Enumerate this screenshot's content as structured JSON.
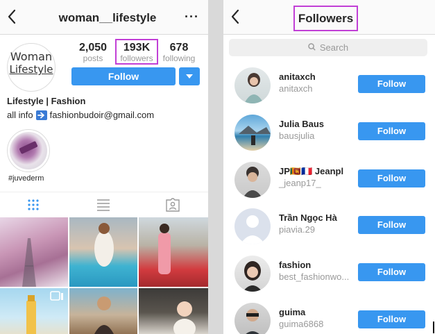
{
  "left_panel": {
    "username": "woman__lifestyle",
    "avatar_logo": {
      "line1": "Woman",
      "line2": "Lifestyle"
    },
    "stats": [
      {
        "number": "2,050",
        "label": "posts"
      },
      {
        "number": "193K",
        "label": "followers"
      },
      {
        "number": "678",
        "label": "following"
      }
    ],
    "follow_label": "Follow",
    "bio_name": "Lifestyle | Fashion",
    "bio_prefix": "all info",
    "bio_email": "fashionbudoir@gmail.com",
    "highlight_label": "#juvederm",
    "more_label": "···"
  },
  "right_panel": {
    "title": "Followers",
    "search_placeholder": "Search",
    "followers": [
      {
        "name": "anitaxch",
        "handle": "anitaxch",
        "button": "Follow"
      },
      {
        "name": "Julia Baus",
        "handle": "bausjulia",
        "button": "Follow"
      },
      {
        "name": "JP🇱🇰🇫🇷 Jeanpl",
        "handle": "_jeanp17_",
        "button": "Follow"
      },
      {
        "name": "Trần Ngọc Hà",
        "handle": "piavia.29",
        "button": "Follow"
      },
      {
        "name": "fashion",
        "handle": "best_fashionwo...",
        "button": "Follow"
      },
      {
        "name": "guima",
        "handle": "guima6868",
        "button": "Follow"
      }
    ]
  },
  "colors": {
    "accent_blue": "#3897f0",
    "highlight_box": "#c13fd6",
    "divider": "#d9d9d9"
  },
  "icons": [
    "back-chevron-icon",
    "more-dots-icon",
    "caret-down-icon",
    "arrow-right-emoji-icon",
    "grid-icon",
    "list-icon",
    "tagged-icon",
    "search-icon",
    "carousel-icon"
  ]
}
